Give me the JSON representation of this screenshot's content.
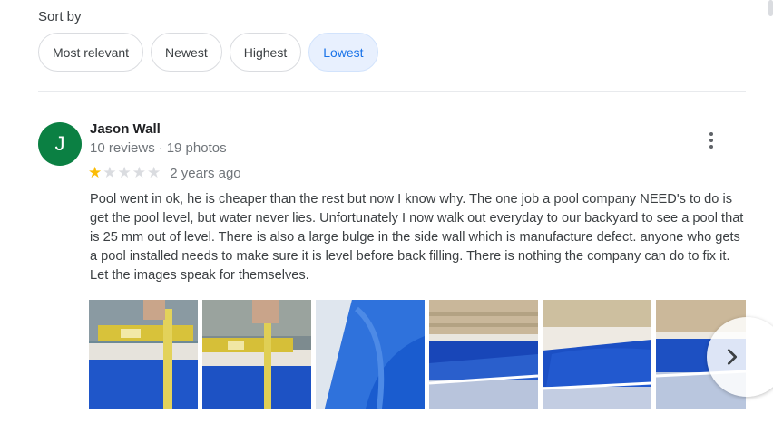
{
  "sort": {
    "label": "Sort by",
    "options": [
      "Most relevant",
      "Newest",
      "Highest",
      "Lowest"
    ],
    "selected": "Lowest"
  },
  "review": {
    "avatar_initial": "J",
    "avatar_color": "#0b8043",
    "author": "Jason Wall",
    "reviews_count": "10 reviews",
    "photos_count": "19 photos",
    "rating": 1,
    "max_rating": 5,
    "date": "2 years ago",
    "text": "Pool went in ok, he is cheaper than the rest but now I know why.  The one job a pool company NEED's to do is get the pool level, but water never lies. Unfortunately I now walk out everyday to our backyard to see a pool that is 25 mm out of level. There is also a large bulge in the side wall which is manufacture defect. anyone who gets a pool installed needs to make sure it is level before back filling.  There is nothing the company can do to fix it.  Let the images speak for themselves.",
    "photos": [
      "pool level measurement photo",
      "pool level tape measure photo",
      "pool wall bulge photo",
      "pool water view photo",
      "pool edge photo",
      "pool steps photo"
    ]
  },
  "colors": {
    "accent": "#1a73e8",
    "selected_chip_bg": "#e8f0fe",
    "star_filled": "#fbbc04",
    "star_empty": "#dadce0"
  }
}
